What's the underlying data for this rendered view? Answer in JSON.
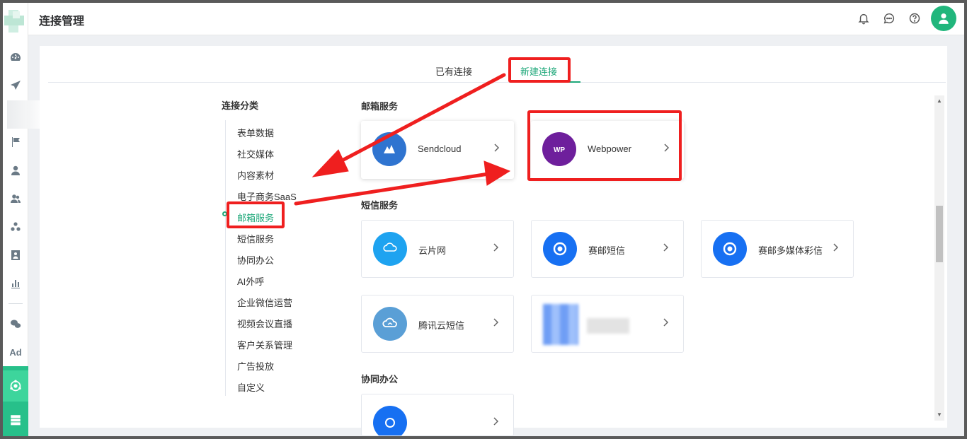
{
  "header": {
    "title": "连接管理"
  },
  "tabs": [
    {
      "label": "已有连接",
      "active": false
    },
    {
      "label": "新建连接",
      "active": true
    }
  ],
  "categories": {
    "title": "连接分类",
    "items": [
      {
        "label": "表单数据"
      },
      {
        "label": "社交媒体"
      },
      {
        "label": "内容素材"
      },
      {
        "label": "电子商务SaaS"
      },
      {
        "label": "邮箱服务",
        "active": true
      },
      {
        "label": "短信服务"
      },
      {
        "label": "协同办公"
      },
      {
        "label": "AI外呼"
      },
      {
        "label": "企业微信运营"
      },
      {
        "label": "视频会议直播"
      },
      {
        "label": "客户关系管理"
      },
      {
        "label": "广告投放"
      },
      {
        "label": "自定义"
      }
    ]
  },
  "sections": {
    "email": {
      "title": "邮箱服务",
      "services": [
        {
          "name": "Sendcloud",
          "icon": "sendcloud-logo"
        },
        {
          "name": "Webpower",
          "icon": "webpower-logo"
        }
      ]
    },
    "sms": {
      "title": "短信服务",
      "services": [
        {
          "name": "云片网",
          "icon": "yunpian-logo"
        },
        {
          "name": "赛邮短信",
          "icon": "submail-logo"
        },
        {
          "name": "赛邮多媒体彩信",
          "icon": "submail-logo"
        },
        {
          "name": "腾讯云短信",
          "icon": "tencent-cloud-logo"
        },
        {
          "name": "",
          "icon": "blurred-logo"
        }
      ]
    },
    "office": {
      "title": "协同办公",
      "services": [
        {
          "name": "",
          "icon": "wecom-logo"
        }
      ]
    }
  },
  "sidebar": {
    "ad_label": "Ad",
    "icons": [
      "dashboard-icon",
      "send-icon",
      "flag-icon",
      "user-icon",
      "users-icon",
      "cluster-icon",
      "contact-card-icon",
      "bar-chart-icon",
      "wechat-icon",
      "ad-icon",
      "connection-icon",
      "server-icon"
    ]
  },
  "colors": {
    "accent": "#1fa87a",
    "annotation": "#ef1f1f",
    "sendcloud": "#2f74d0",
    "webpower": "#6e1f9c",
    "yunpian": "#1ea3f0",
    "submail": "#1770f2",
    "tencent": "#5a9fd6"
  }
}
